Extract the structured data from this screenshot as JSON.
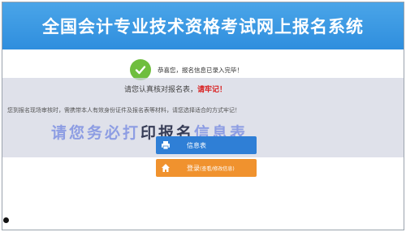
{
  "header": {
    "title": "全国会计专业技术资格考试网上报名系统"
  },
  "success": {
    "message": "恭喜您，报名信息已录入完毕！"
  },
  "notice": {
    "line1_prefix": "请您认真核对报名表，",
    "line1_emphasis": "请牢记！",
    "line2": "您到报名现场审核时，需携带本人有效身份证件及报名表等材料，请您选择适合的方式牢记！",
    "blurred_left": "请您务必打",
    "blurred_mid": "印报名",
    "blurred_right": "信息表"
  },
  "buttons": {
    "print_label": "信息表",
    "login_label": "登录",
    "login_sub": "(查看/修改信息)"
  },
  "colors": {
    "header_bg": "#2f8ede",
    "check_green": "#6fbe3e",
    "print_btn": "#2f7fd6",
    "login_btn": "#f0922e",
    "notice_red": "#d92020"
  },
  "icons": {
    "success": "check-circle-icon",
    "print": "print-icon",
    "login": "home-icon"
  }
}
